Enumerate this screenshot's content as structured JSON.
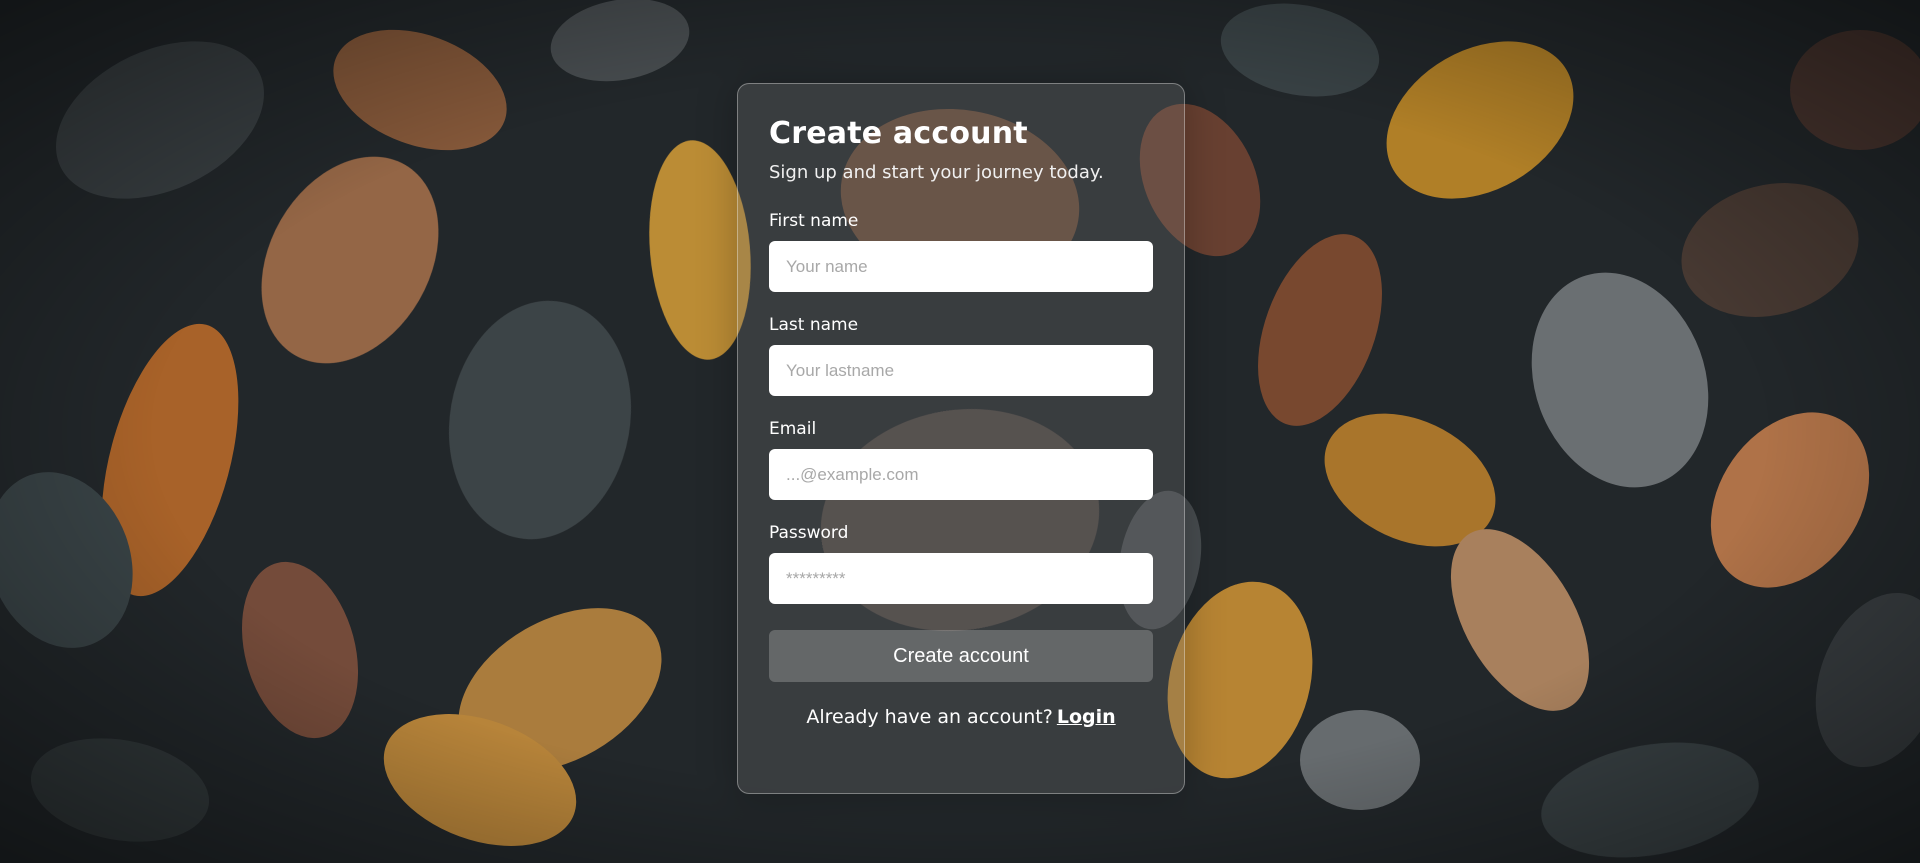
{
  "form": {
    "title": "Create account",
    "subtitle": "Sign up and start your journey today.",
    "fields": [
      {
        "label": "First name",
        "placeholder": "Your name",
        "value": ""
      },
      {
        "label": "Last name",
        "placeholder": "Your lastname",
        "value": ""
      },
      {
        "label": "Email",
        "placeholder": "...@example.com",
        "value": ""
      },
      {
        "label": "Password",
        "placeholder": "*********",
        "value": ""
      }
    ],
    "submit_label": "Create account",
    "footer_text": "Already have an account?",
    "login_link": "Login"
  },
  "colors": {
    "card_border": "#ffffff",
    "input_background": "#ffffff",
    "placeholder": "#a8a8a8",
    "text": "#ffffff"
  }
}
